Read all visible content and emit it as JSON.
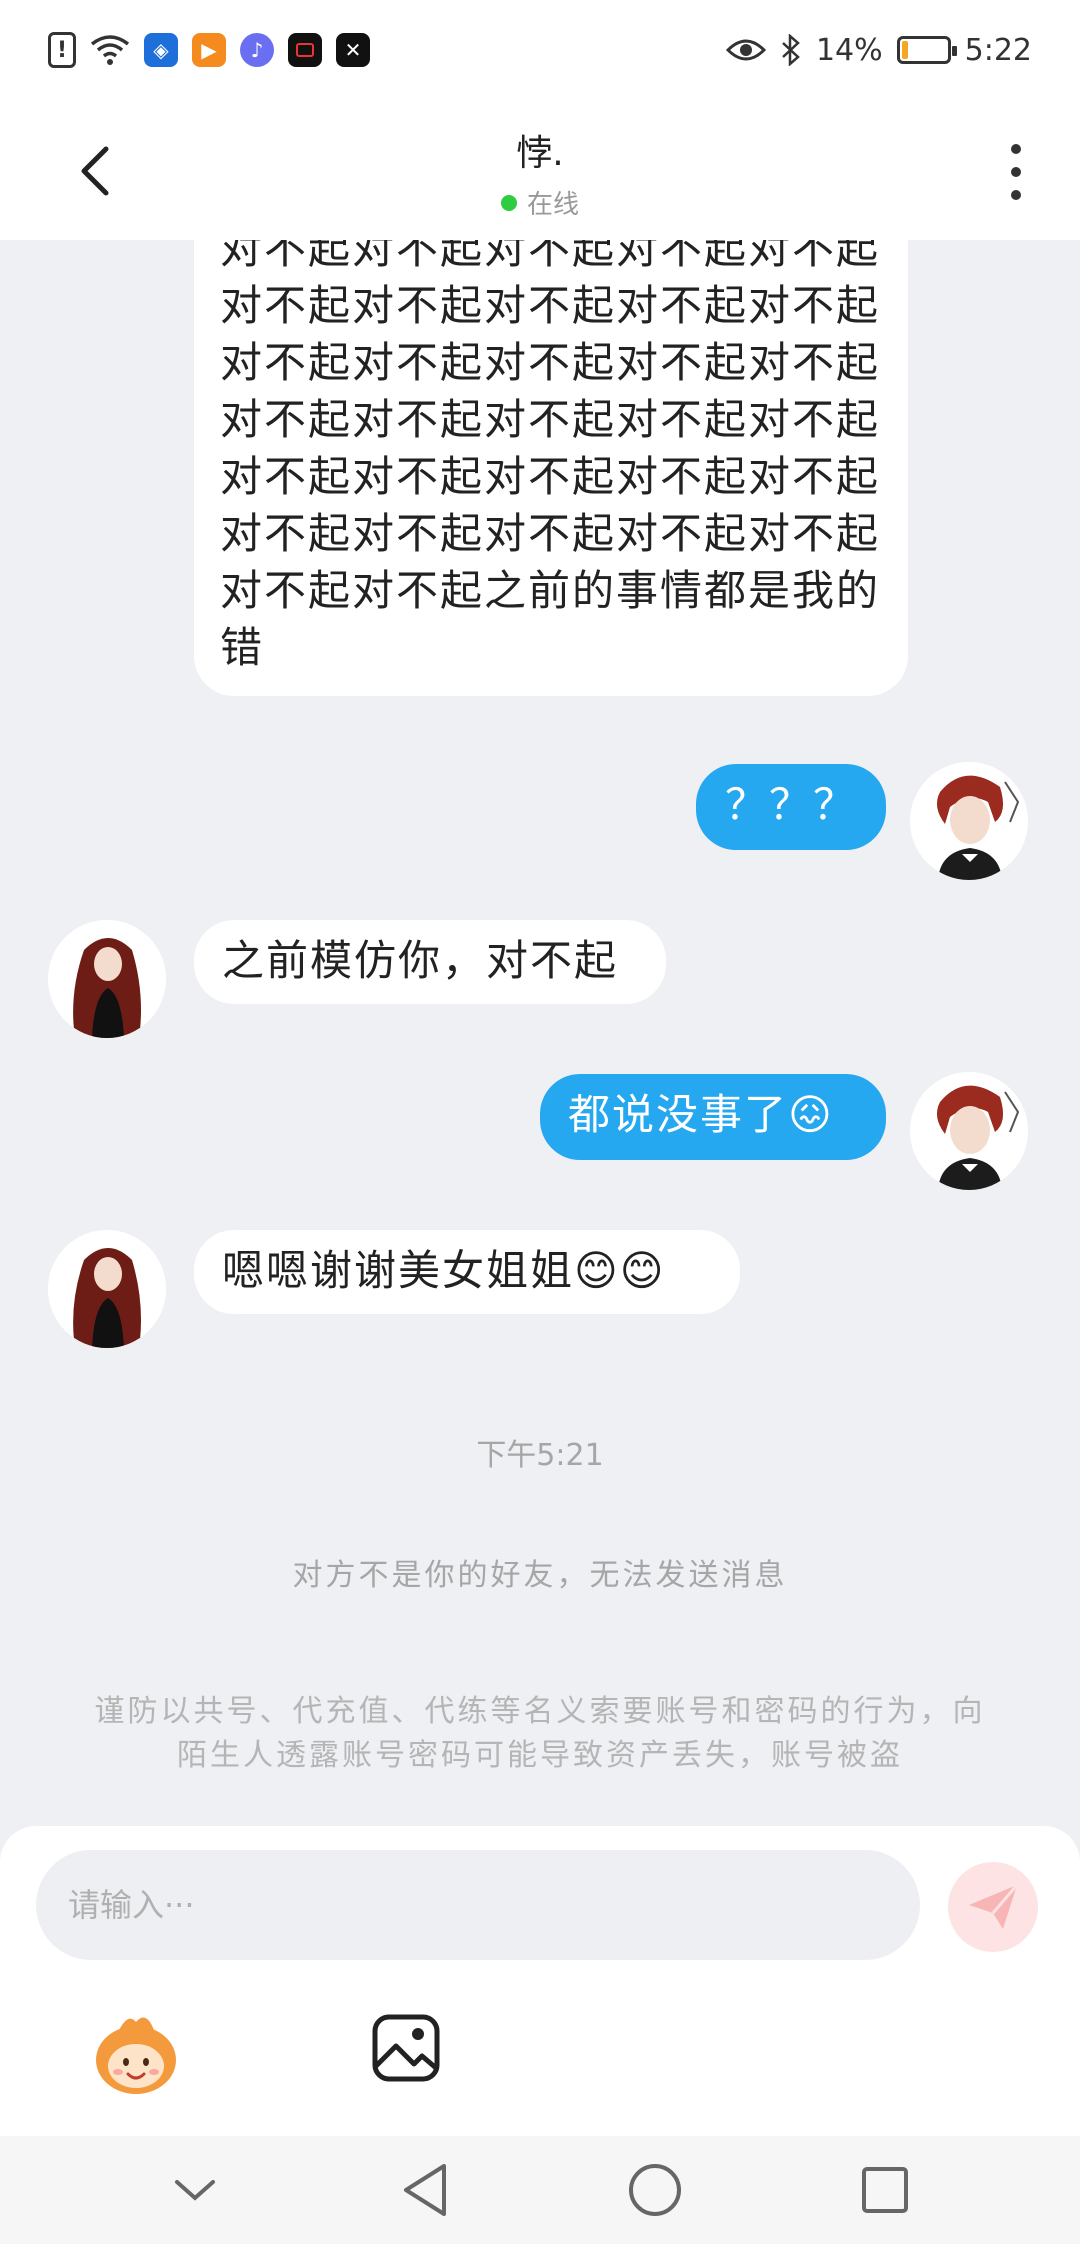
{
  "status_bar": {
    "battery_percent": "14%",
    "battery_level": 0.14,
    "time": "5:22",
    "icons": [
      "alert-icon",
      "wifi-icon",
      "shield-app-icon",
      "video-app-icon",
      "music-app-icon",
      "camera-app-icon",
      "capcut-app-icon",
      "eye-icon",
      "bluetooth-icon",
      "battery-icon"
    ]
  },
  "header": {
    "name": "悖.",
    "status": "在线",
    "status_color": "#2ecc40"
  },
  "messages": [
    {
      "side": "in",
      "text": "对不起对不起对不起对不起对不起对不起对不起对不起对不起对不起对不起对不起对不起对不起对不起对不起对不起对不起对不起对不起对不起对不起对不起对不起对不起对不起对不起对不起对不起对不起对不起对不起之前的事情都是我的错"
    },
    {
      "side": "out",
      "text": "？？？"
    },
    {
      "side": "in",
      "text": "之前模仿你，对不起"
    },
    {
      "side": "out",
      "text": "都说没事了😖"
    },
    {
      "side": "in",
      "text": "嗯嗯谢谢美女姐姐😊😊"
    }
  ],
  "time_label": "下午5:21",
  "notice": "对方不是你的好友，无法发送消息",
  "warning": "谨防以共号、代充值、代练等名义索要账号和密码的行为，向陌生人透露账号密码可能导致资产丢失，账号被盗",
  "input": {
    "placeholder": "请输入···"
  },
  "colors": {
    "outgoing_bubble": "#26a8f0",
    "incoming_bubble": "#ffffff",
    "background": "#eef0f4",
    "send_button": "#fde3e3"
  }
}
